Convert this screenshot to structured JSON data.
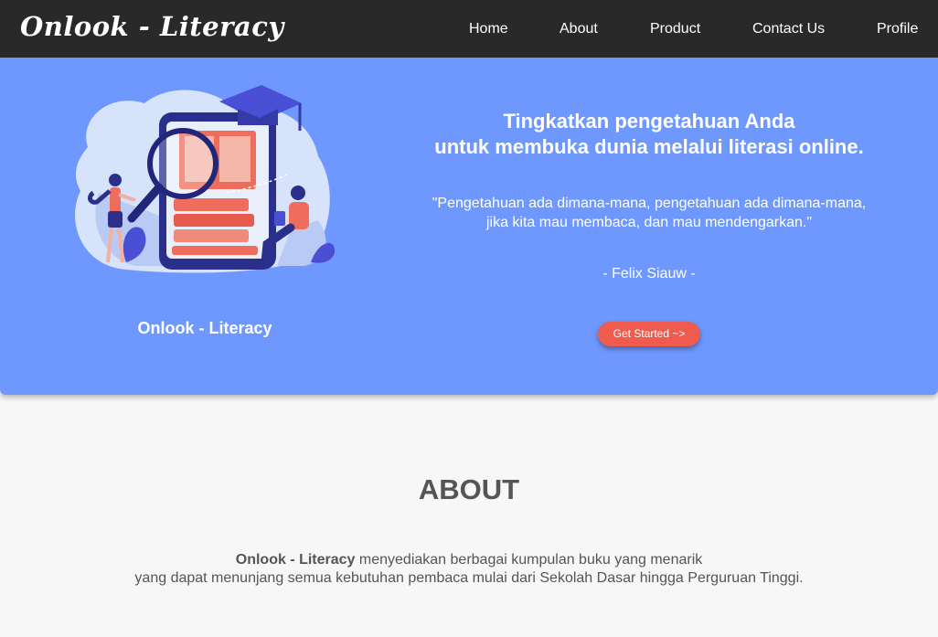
{
  "nav": {
    "brand": "Onlook - Literacy",
    "links": [
      "Home",
      "About",
      "Product",
      "Contact Us",
      "Profile"
    ]
  },
  "hero": {
    "caption": "Onlook - Literacy",
    "headline_line1": "Tingkatkan pengetahuan Anda",
    "headline_line2": "untuk membuka dunia melalui literasi online.",
    "quote_line1": "\"Pengetahuan ada dimana-mana, pengetahuan ada dimana-mana,",
    "quote_line2": "jika kita mau membaca, dan mau mendengarkan.\"",
    "author": "- Felix Siauw -",
    "cta_label": "Get Started ~>"
  },
  "about": {
    "title": "ABOUT",
    "brand": "Onlook - Literacy",
    "text_line1_rest": " menyediakan berbagai kumpulan buku yang menarik",
    "text_line2": "yang dapat menunjang semua kebutuhan pembaca mulai dari Sekolah Dasar hingga Perguruan Tinggi."
  },
  "colors": {
    "navbar": "#292929",
    "hero": "#6f98ff",
    "cta": "#ef5b4f",
    "page_bg": "#f7f7f7"
  }
}
